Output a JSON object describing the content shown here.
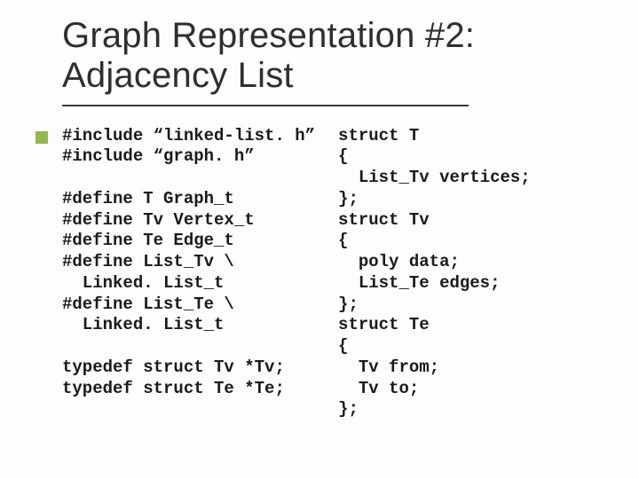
{
  "title": {
    "line1": "Graph Representation #2:",
    "line2": "Adjacency List"
  },
  "code": {
    "left": "#include “linked-list. h”\n#include “graph. h”\n\n#define T Graph_t\n#define Tv Vertex_t\n#define Te Edge_t\n#define List_Tv \\\n  Linked. List_t\n#define List_Te \\\n  Linked. List_t\n\ntypedef struct Tv *Tv;\ntypedef struct Te *Te;",
    "right": "struct T\n{\n  List_Tv vertices;\n};\nstruct Tv\n{\n  poly data;\n  List_Te edges;\n};\nstruct Te\n{\n  Tv from;\n  Tv to;\n};"
  }
}
